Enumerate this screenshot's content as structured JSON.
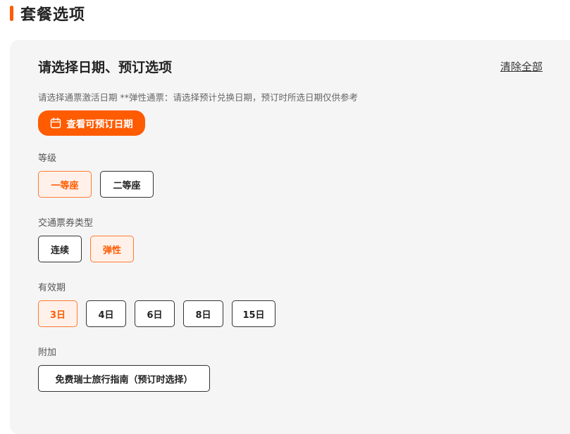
{
  "section": {
    "title": "套餐选项"
  },
  "card": {
    "title": "请选择日期、预订选项",
    "clear_all": "清除全部",
    "hint": "请选择通票激活日期 **弹性通票：请选择预计兑换日期，预订时所选日期仅供参考",
    "calendar_button": "查看可预订日期"
  },
  "groups": {
    "class": {
      "label": "等级",
      "options": [
        "一等座",
        "二等座"
      ],
      "selected": "一等座"
    },
    "pass_type": {
      "label": "交通票券类型",
      "options": [
        "连续",
        "弹性"
      ],
      "selected": "弹性"
    },
    "validity": {
      "label": "有效期",
      "options": [
        "3日",
        "4日",
        "6日",
        "8日",
        "15日"
      ],
      "selected": "3日"
    },
    "extras": {
      "label": "附加",
      "options": [
        "免费瑞士旅行指南（预订时选择）"
      ]
    }
  },
  "colors": {
    "accent": "#ff5b00",
    "selected_bg": "#fff1ea",
    "card_bg": "#f5f5f5"
  },
  "icons": {
    "calendar_button": "calendar-icon"
  }
}
